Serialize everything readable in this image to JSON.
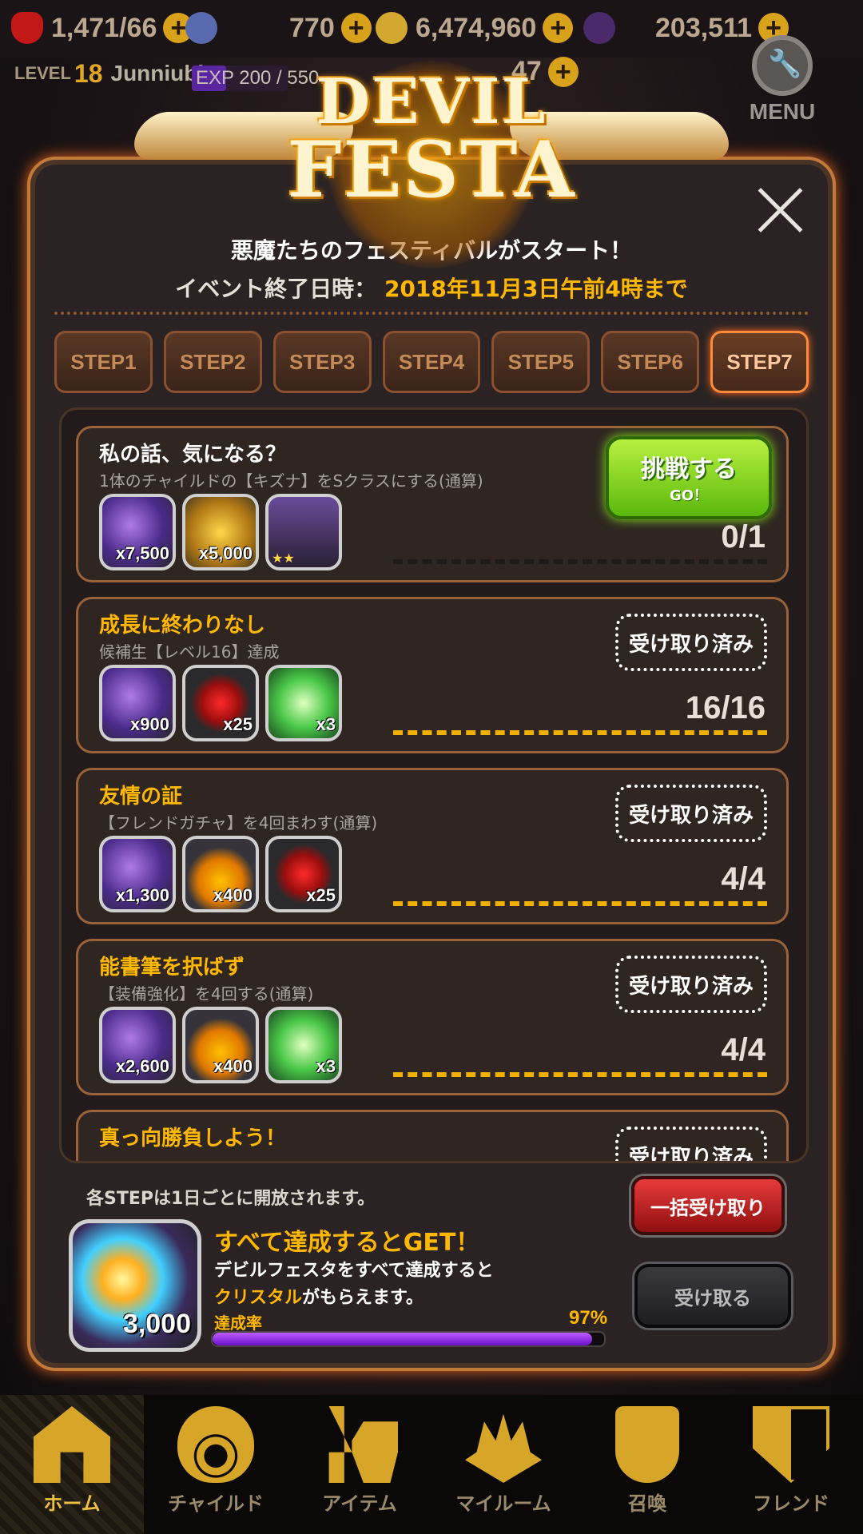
{
  "status": {
    "hearts": "1,471/66",
    "gems": "770",
    "coins": "6,474,960",
    "crystals": "203,511",
    "level_label": "LEVEL",
    "level": "18",
    "player": "Junniubi",
    "exp": "EXP 200 / 550",
    "exp_progress": 0.36,
    "stamina": "47",
    "menu": "MENU"
  },
  "logo": {
    "line1": "DEVIL",
    "line2": "FESTA"
  },
  "event": {
    "headline": "悪魔たちのフェスティバルがスタート！",
    "end_label": "イベント終了日時：",
    "end_value": "2018年11月3日午前4時まで"
  },
  "tabs": [
    "STEP1",
    "STEP2",
    "STEP3",
    "STEP4",
    "STEP5",
    "STEP6",
    "STEP7"
  ],
  "active_tab": "STEP7",
  "missions": [
    {
      "title": "私の話、気になる？",
      "desc": "1体のチャイルドの【キズナ】をSクラスにする(通算)",
      "rewards": [
        {
          "icon": "gem-icon",
          "count": "x7,500"
        },
        {
          "icon": "coin-icon",
          "count": "x5,000"
        },
        {
          "icon": "child-card-icon",
          "count": ""
        }
      ],
      "action": {
        "type": "go",
        "label": "挑戦する",
        "sub": "GO！"
      },
      "progress": "0/1",
      "progress_ratio": 0
    },
    {
      "title": "成長に終わりなし",
      "desc": "候補生【レベル16】達成",
      "rewards": [
        {
          "icon": "gem-icon",
          "count": "x900"
        },
        {
          "icon": "heart-icon",
          "count": "x25"
        },
        {
          "icon": "ticket-icon",
          "count": "x3"
        }
      ],
      "action": {
        "type": "done",
        "label": "受け取り済み"
      },
      "progress": "16/16",
      "progress_ratio": 1
    },
    {
      "title": "友情の証",
      "desc": "【フレンドガチャ】を4回まわす(通算)",
      "rewards": [
        {
          "icon": "gem-icon",
          "count": "x1,300"
        },
        {
          "icon": "medal-icon",
          "count": "x400"
        },
        {
          "icon": "heart-icon",
          "count": "x25"
        }
      ],
      "action": {
        "type": "done",
        "label": "受け取り済み"
      },
      "progress": "4/4",
      "progress_ratio": 1
    },
    {
      "title": "能書筆を択ばず",
      "desc": "【装備強化】を4回する(通算)",
      "rewards": [
        {
          "icon": "gem-icon",
          "count": "x2,600"
        },
        {
          "icon": "medal-icon",
          "count": "x400"
        },
        {
          "icon": "ticket-icon",
          "count": "x3"
        }
      ],
      "action": {
        "type": "done",
        "label": "受け取り済み"
      },
      "progress": "4/4",
      "progress_ratio": 1
    },
    {
      "title": "真っ向勝負しよう！",
      "desc": "",
      "rewards": [],
      "action": {
        "type": "done",
        "label": "受け取り済み"
      },
      "progress": "",
      "progress_ratio": 1
    }
  ],
  "footer": {
    "note": "各STEPは1日ごとに開放されます。",
    "bulk_button": "一括受け取り",
    "bonus_count": "3,000",
    "bonus_title": "すべて達成するとGET！",
    "bonus_desc1": "デビルフェスタをすべて達成すると",
    "bonus_desc2_hl": "クリスタル",
    "bonus_desc2_rest": "がもらえます。",
    "rate_label": "達成率",
    "rate_value": "97%",
    "rate_ratio": 0.97,
    "claim_button": "受け取る"
  },
  "nav": [
    {
      "label": "ホーム",
      "icon": "home-icon",
      "active": true
    },
    {
      "label": "チャイルド",
      "icon": "child-icon",
      "active": false
    },
    {
      "label": "アイテム",
      "icon": "item-icon",
      "active": false
    },
    {
      "label": "マイルーム",
      "icon": "my-room-icon",
      "active": false
    },
    {
      "label": "召喚",
      "icon": "summon-icon",
      "active": false
    },
    {
      "label": "フレンド",
      "icon": "friend-icon",
      "active": false
    }
  ],
  "colors": {
    "accent": "#ffb700",
    "panel_border": "#c27a3a",
    "go_green": "#5ab80c",
    "bulk_red": "#e83a3a",
    "rate_purple": "#a030f0"
  }
}
